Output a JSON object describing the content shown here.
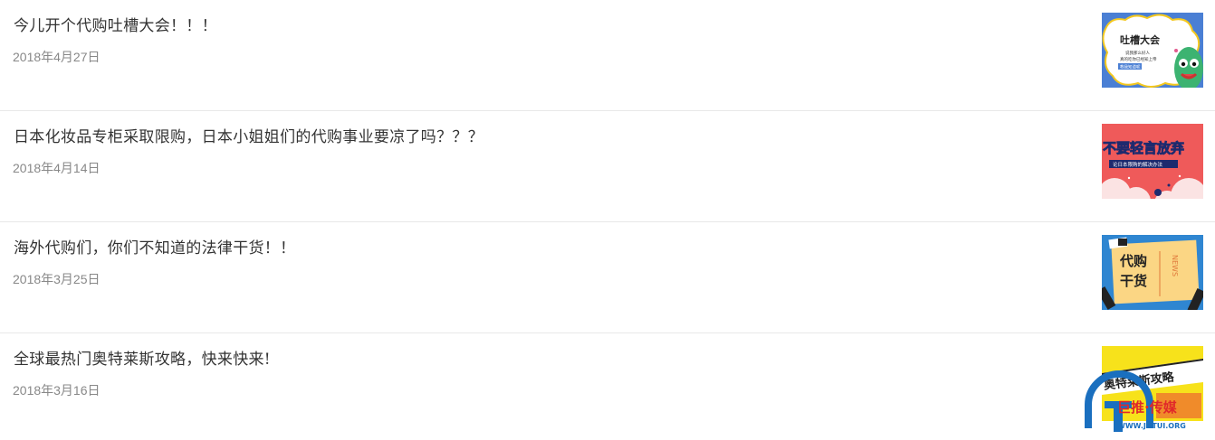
{
  "articles": [
    {
      "title": "今儿开个代购吐槽大会！！！",
      "date": "2018年4月27日",
      "thumb": {
        "line1": "吐槽大会",
        "line2": "说我那么好人",
        "line3": "真的吃你已经知上帝",
        "tag": "教我知道呢",
        "bg": "#4a7fd4"
      }
    },
    {
      "title": "日本化妆品专柜采取限购，日本小姐姐们的代购事业要凉了吗？？？",
      "date": "2018年4月14日",
      "thumb": {
        "line1": "不要轻言放弃",
        "line2": "论日本限购的解决办法",
        "bg": "#ef5a5a"
      }
    },
    {
      "title": "海外代购们，你们不知道的法律干货！！",
      "date": "2018年3月25日",
      "thumb": {
        "line1": "代购",
        "line2": "干货",
        "side": "NEWS",
        "bg": "#2f86d1"
      }
    },
    {
      "title": "全球最热门奥特莱斯攻略，快来快来!",
      "date": "2018年3月16日",
      "thumb": {
        "line1": "奥特莱斯攻略",
        "bg": "#f7e21b"
      }
    }
  ],
  "watermark": {
    "brand": "巨推·传媒",
    "url": "WWW.JUTUI.ORG"
  }
}
